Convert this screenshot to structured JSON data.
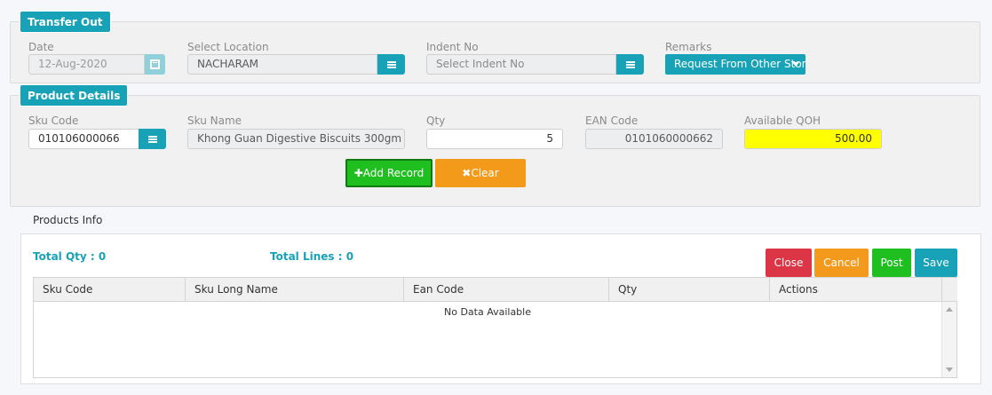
{
  "transfer_out": {
    "legend": "Transfer Out",
    "date": {
      "label": "Date",
      "value": "12-Aug-2020"
    },
    "location": {
      "label": "Select Location",
      "value": "NACHARAM"
    },
    "indent": {
      "label": "Indent No",
      "placeholder": "Select Indent No"
    },
    "remarks": {
      "label": "Remarks",
      "value": "Request From Other Store"
    }
  },
  "product_details": {
    "legend": "Product Details",
    "sku_code": {
      "label": "Sku Code",
      "value": "010106000066"
    },
    "sku_name": {
      "label": "Sku Name",
      "value": "Khong Guan Digestive Biscuits 300gm"
    },
    "qty": {
      "label": "Qty",
      "value": "5"
    },
    "ean_code": {
      "label": "EAN Code",
      "value": "0101060000662"
    },
    "available_qoh": {
      "label": "Available QOH",
      "value": "500.00"
    },
    "add_record_label": "Add Record",
    "clear_label": "Clear"
  },
  "products_info": {
    "title": "Products Info",
    "total_qty": "Total Qty : 0",
    "total_lines": "Total Lines : 0",
    "buttons": {
      "close": "Close",
      "cancel": "Cancel",
      "post": "Post",
      "save": "Save"
    },
    "columns": [
      "Sku Code",
      "Sku Long Name",
      "Ean Code",
      "Qty",
      "Actions"
    ],
    "empty_text": "No Data Available"
  },
  "icons": {
    "calendar": "calendar-icon",
    "menu": "hamburger-icon",
    "dropdown": "caret-down-icon",
    "plus": "plus-icon",
    "times": "times-icon"
  },
  "colors": {
    "accent": "#17a2b8",
    "success": "#1fbf1f",
    "warning": "#f49a1a",
    "danger": "#dc3545",
    "highlight": "#ffff00"
  }
}
